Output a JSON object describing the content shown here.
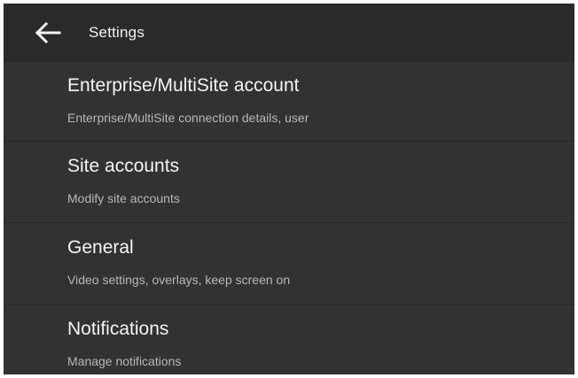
{
  "appbar": {
    "back_icon": "arrow-left-icon",
    "title": "Settings"
  },
  "colors": {
    "background": "#2f2f2f",
    "appbar": "#2a2a2a",
    "title_text": "#f4f4f4",
    "subtitle_text": "#b8b8b8"
  },
  "settings": {
    "items": [
      {
        "title": "Enterprise/MultiSite account",
        "subtitle": "Enterprise/MultiSite connection details, user"
      },
      {
        "title": "Site accounts",
        "subtitle": "Modify site accounts"
      },
      {
        "title": "General",
        "subtitle": "Video settings, overlays, keep screen on"
      },
      {
        "title": "Notifications",
        "subtitle": "Manage notifications"
      }
    ]
  }
}
